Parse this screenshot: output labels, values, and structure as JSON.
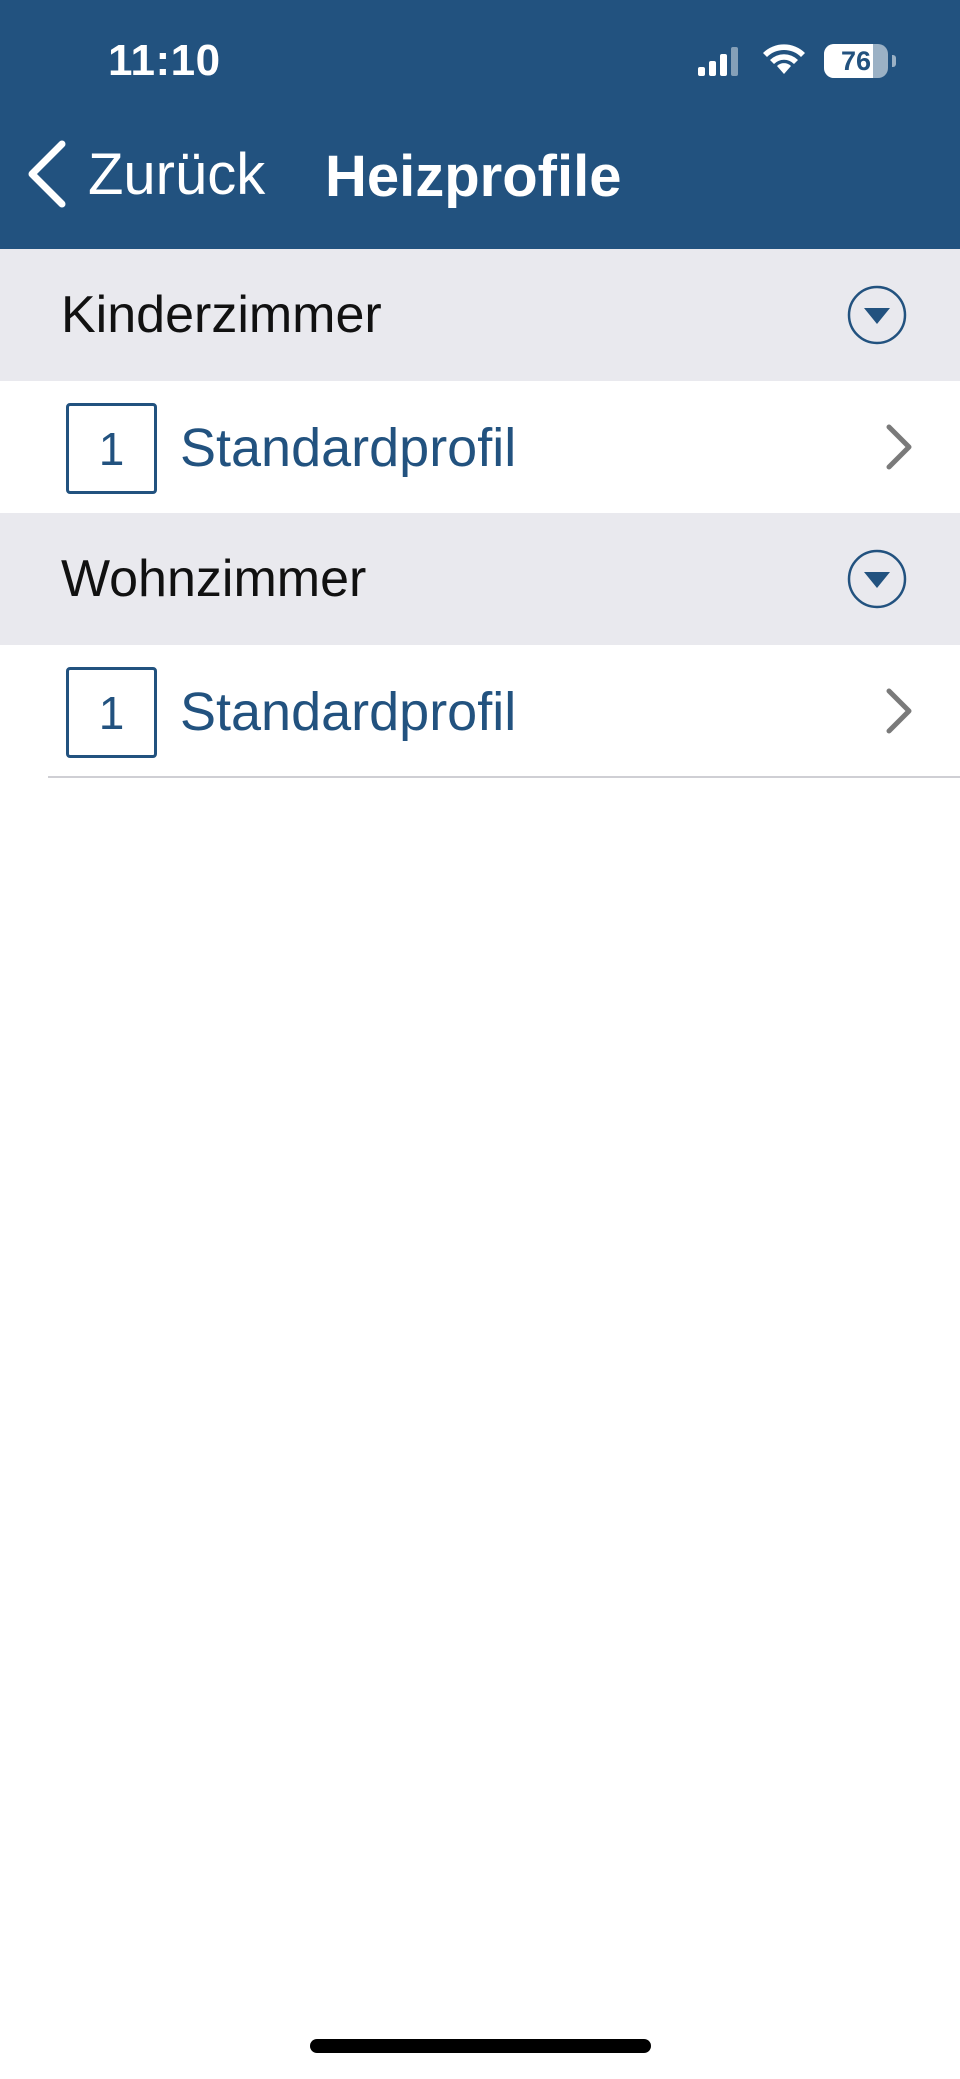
{
  "status_bar": {
    "time": "11:10",
    "battery_percent": "76",
    "battery_level": 0.76,
    "icons": [
      "signal-icon",
      "wifi-icon",
      "battery-icon"
    ]
  },
  "nav": {
    "back_label": "Zurück",
    "title": "Heizprofile"
  },
  "sections": [
    {
      "title": "Kinderzimmer",
      "profiles": [
        {
          "number": "1",
          "name": "Standardprofil"
        }
      ]
    },
    {
      "title": "Wohnzimmer",
      "profiles": [
        {
          "number": "1",
          "name": "Standardprofil"
        }
      ]
    }
  ],
  "colors": {
    "header_bg": "#22527f",
    "accent": "#22527f",
    "section_bg": "#e9e9ee",
    "chevron": "#7a7a7a"
  }
}
